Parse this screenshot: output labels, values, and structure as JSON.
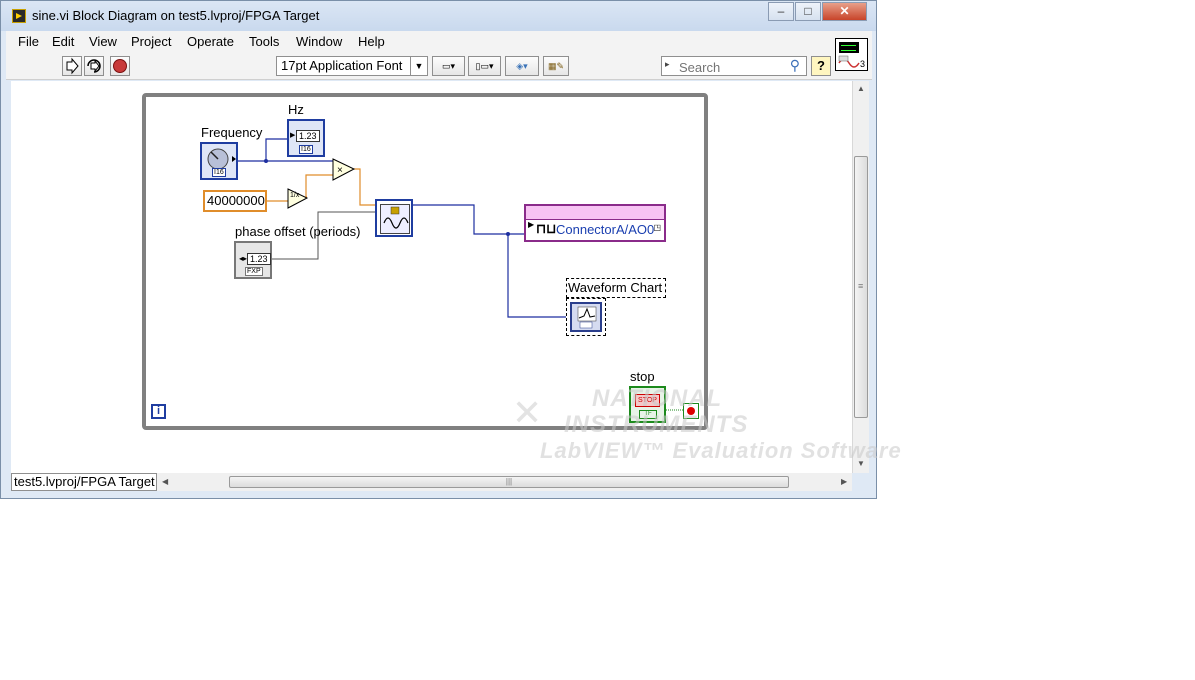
{
  "window": {
    "title": "sine.vi Block Diagram on test5.lvproj/FPGA Target"
  },
  "menu": [
    "File",
    "Edit",
    "View",
    "Project",
    "Operate",
    "Tools",
    "Window",
    "Help"
  ],
  "toolbar": {
    "font": "17pt Application Font",
    "search_placeholder": "Search",
    "help": "?"
  },
  "vi_icon": {
    "number": "3"
  },
  "context": "test5.lvproj/FPGA Target",
  "diagram": {
    "frequency_label": "Frequency",
    "hz_label": "Hz",
    "constant": "40000000",
    "phase_label": "phase offset (periods)",
    "io_node": "ConnectorA/AO0",
    "chart_label": "Waveform Chart",
    "stop_label": "stop",
    "num_123": "1.23",
    "i32": "I16",
    "fxp": "FXP",
    "tf": "TF",
    "stop_btn": "STOP",
    "loop_index": "i"
  },
  "watermark": {
    "line1": "NATIONAL",
    "line2": "INSTRUMENTS",
    "line3": "LabVIEW™ Evaluation Software"
  }
}
